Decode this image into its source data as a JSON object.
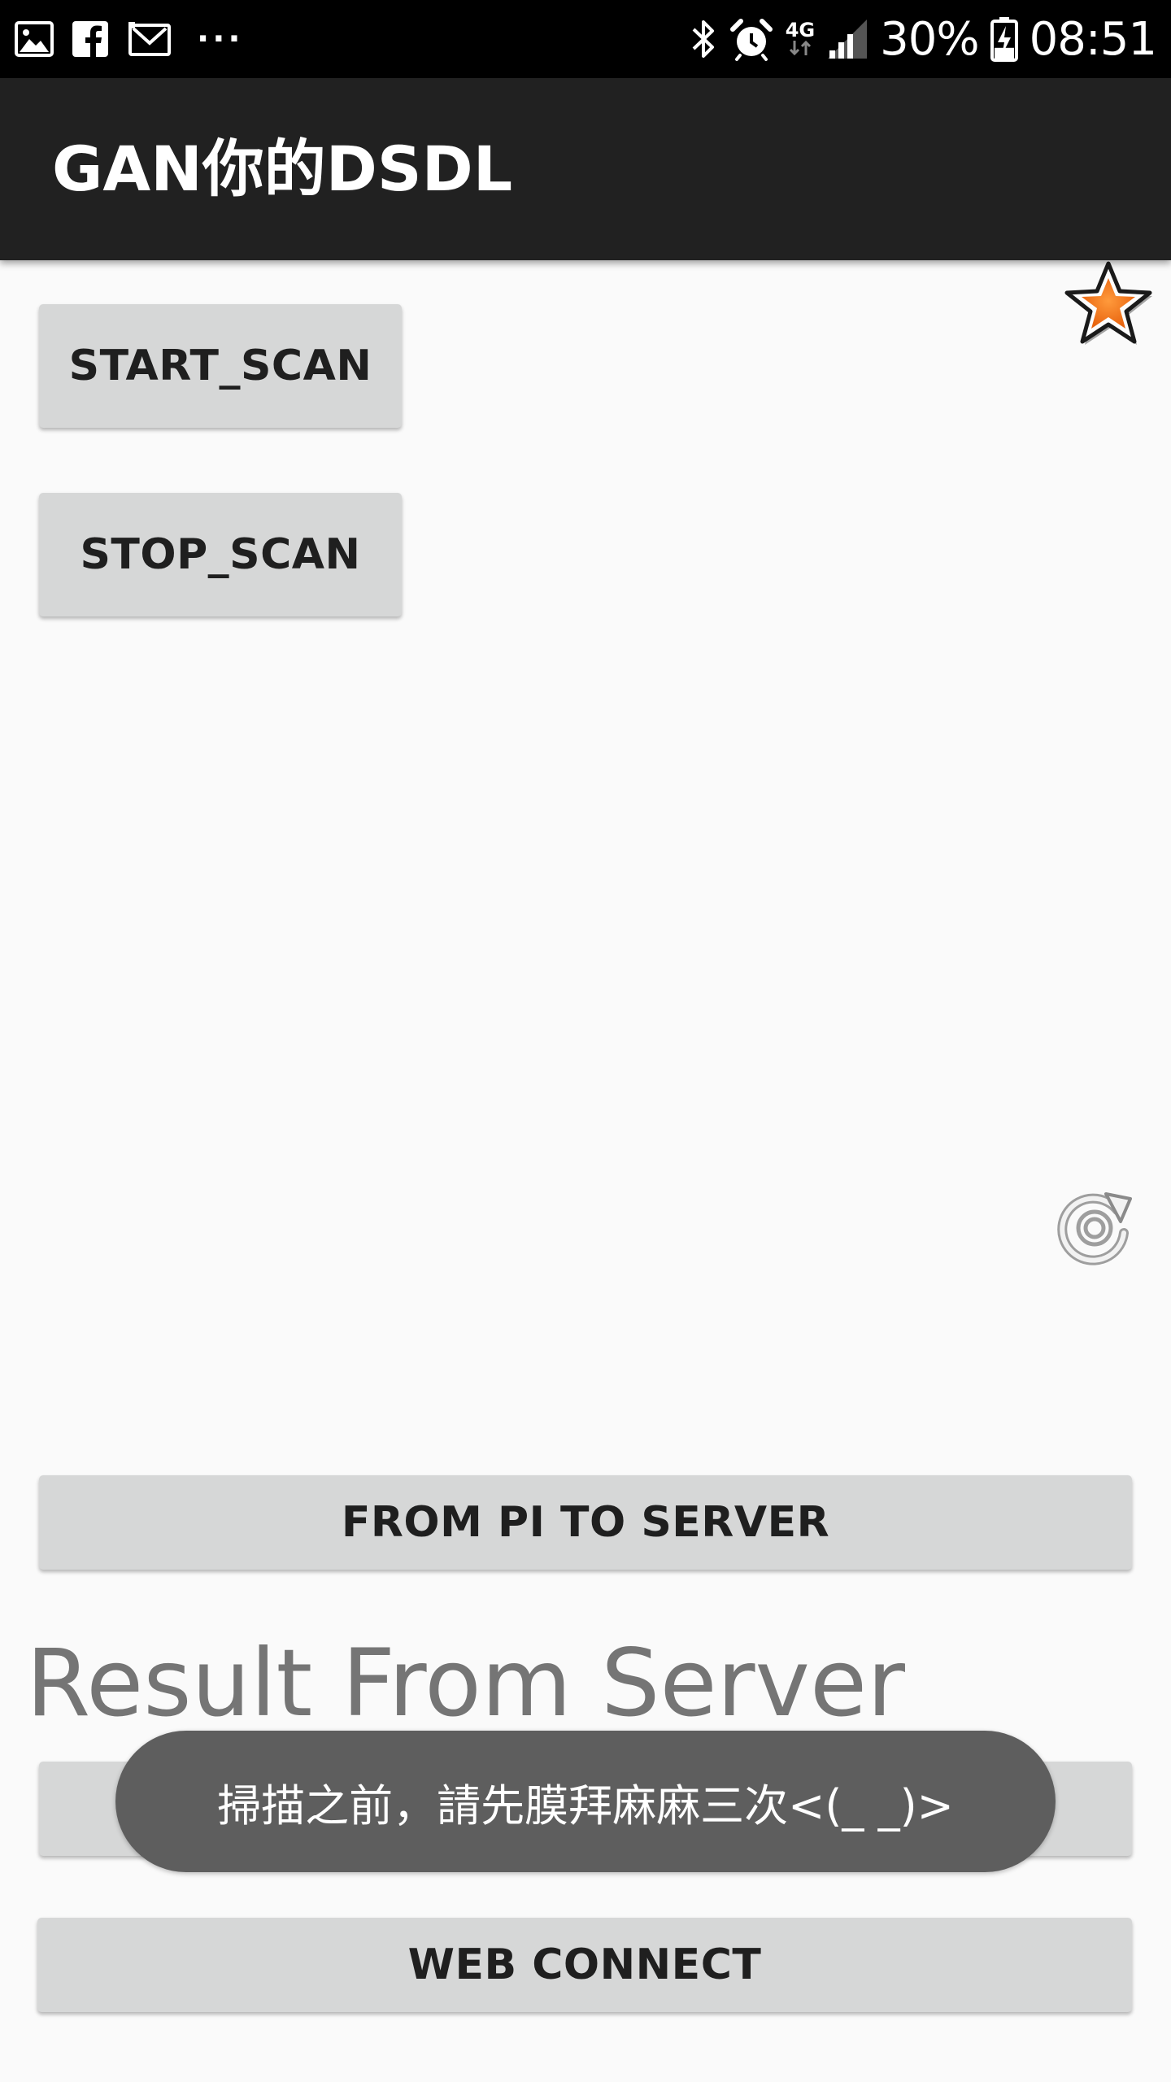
{
  "status_bar": {
    "icons_left": [
      "gallery-icon",
      "facebook-icon",
      "gmail-icon",
      "more-notifications-icon"
    ],
    "more_glyph": "···",
    "icons_right": [
      "bluetooth-icon",
      "alarm-icon",
      "network-4g-icon",
      "signal-icon",
      "battery-charging-icon"
    ],
    "network_label": "4G",
    "battery_percent": "30%",
    "battery_level": 0.3,
    "time": "08:51"
  },
  "app_bar": {
    "title": "GAN你的DSDL"
  },
  "buttons": {
    "start_scan": "START_SCAN",
    "stop_scan": "STOP_SCAN",
    "from_pi_to_server": "FROM PI TO SERVER",
    "web_connect": "WEB CONNECT"
  },
  "icons": {
    "favorite": "star-icon",
    "refresh": "refresh-icon"
  },
  "result": {
    "heading": "Result From Server"
  },
  "toast": {
    "message": "掃描之前，請先膜拜麻麻三次<(_ _)>"
  },
  "colors": {
    "status_bar": "#000000",
    "app_bar": "#212121",
    "background": "#fafafa",
    "button": "#d6d7d7",
    "star_fill": "#f57c1f",
    "toast": "#5e5e5e",
    "result_text": "#757575"
  }
}
